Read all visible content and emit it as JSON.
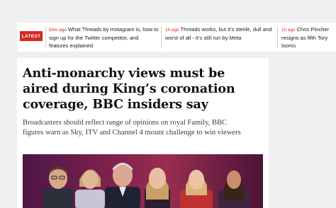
{
  "ticker": {
    "badge_label": "LATEST",
    "items": [
      {
        "time": "50m ago",
        "headline": "What Threads by Instagram is, how to sign up for the Twitter competitor, and features explained"
      },
      {
        "time": "1h ago",
        "headline": "Threads works, but it's sterile, dull and worst of all - it's still run by Meta"
      },
      {
        "time": "1h ago",
        "headline": "Chris Pincher resigns as fifth Tory looms"
      }
    ]
  },
  "article": {
    "headline": "Anti-monarchy views must be aired during King’s coronation coverage, BBC insiders say",
    "standfirst": "Broadcasters should reflect range of opinions on royal Family, BBC figures warn as Sky, ITV and Channel 4 mount challenge to win viewers"
  },
  "colors": {
    "accent_red": "#d32a1f",
    "page_background": "#efefef",
    "card_background": "#ffffff"
  }
}
